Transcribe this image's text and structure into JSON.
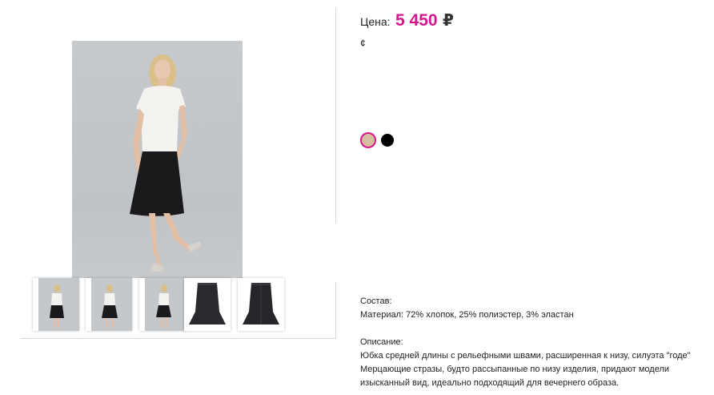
{
  "gallery": {
    "main_image": {
      "alt": "model in white top and black flared midi skirt"
    },
    "thumbnails": [
      {
        "kind": "model-front"
      },
      {
        "kind": "model-pose"
      },
      {
        "kind": "model-side"
      },
      {
        "kind": "skirt-front"
      },
      {
        "kind": "skirt-back"
      }
    ]
  },
  "price": {
    "label": "Цена:",
    "value": "5 450",
    "currency": "₽",
    "accent_color": "#d6168c"
  },
  "small_glyph": "¢",
  "colors": {
    "swatches": [
      {
        "name": "beige",
        "hex": "#d6bfa0",
        "selected": true
      },
      {
        "name": "black",
        "hex": "#000000",
        "selected": false
      }
    ]
  },
  "composition": {
    "heading": "Состав:",
    "material": "Материал: 72% хлопок, 25% полиэстер, 3% эластан"
  },
  "description": {
    "heading": "Описание:",
    "lines": [
      "Юбка средней длины с рельефными швами, расширенная к низу, силуэта \"годе\"",
      "Мерцающие стразы, будто рассыпанные по низу изделия, придают модели",
      "изысканный вид,  идеально подходящий для вечернего образа."
    ]
  }
}
